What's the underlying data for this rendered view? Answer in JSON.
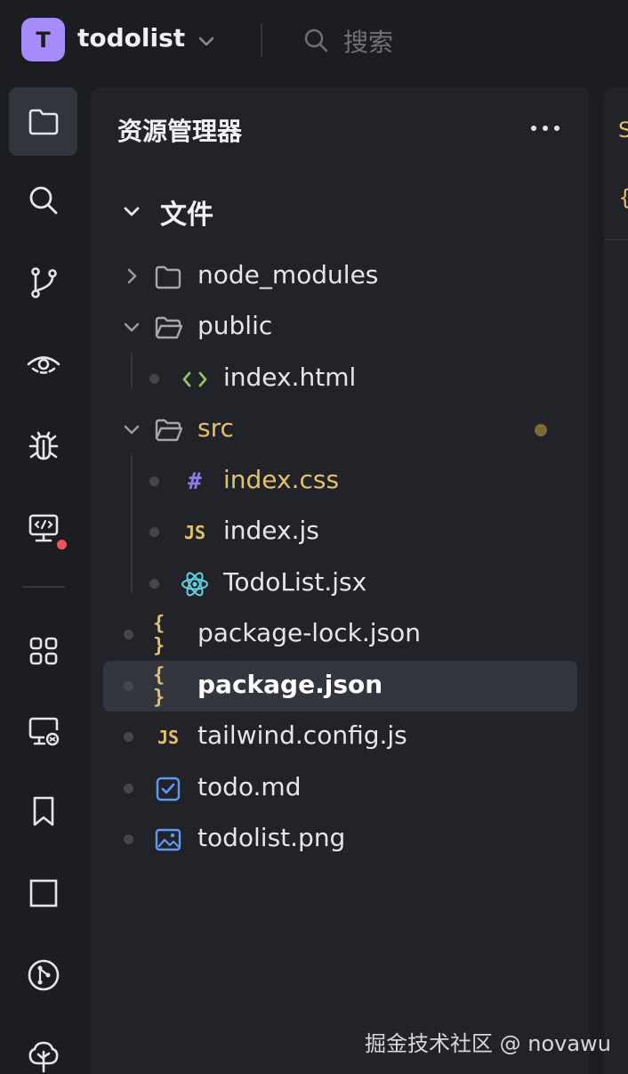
{
  "titlebar": {
    "avatar_letter": "T",
    "project_name": "todolist",
    "search_label": "搜索"
  },
  "explorer": {
    "title": "资源管理器",
    "section_title": "文件",
    "items": [
      {
        "label": "node_modules"
      },
      {
        "label": "public"
      },
      {
        "label": "index.html"
      },
      {
        "label": "src"
      },
      {
        "label": "index.css"
      },
      {
        "label": "index.js"
      },
      {
        "label": "TodoList.jsx"
      },
      {
        "label": "package-lock.json"
      },
      {
        "label": "package.json"
      },
      {
        "label": "tailwind.config.js"
      },
      {
        "label": "todo.md"
      },
      {
        "label": "todolist.png"
      }
    ],
    "js_badge": "JS",
    "hash_badge": "#",
    "brace_badge": "{ }"
  },
  "editor_peek": {
    "glyph_1": "S",
    "glyph_2": "{"
  },
  "watermark": "掘金技术社区 @ novawu",
  "colors": {
    "accent": "#a78bfa",
    "modified": "#e2c16b",
    "html": "#8fc460",
    "css": "#8b7bf0",
    "react": "#5fd3e6",
    "markdown": "#5b9cf5"
  }
}
